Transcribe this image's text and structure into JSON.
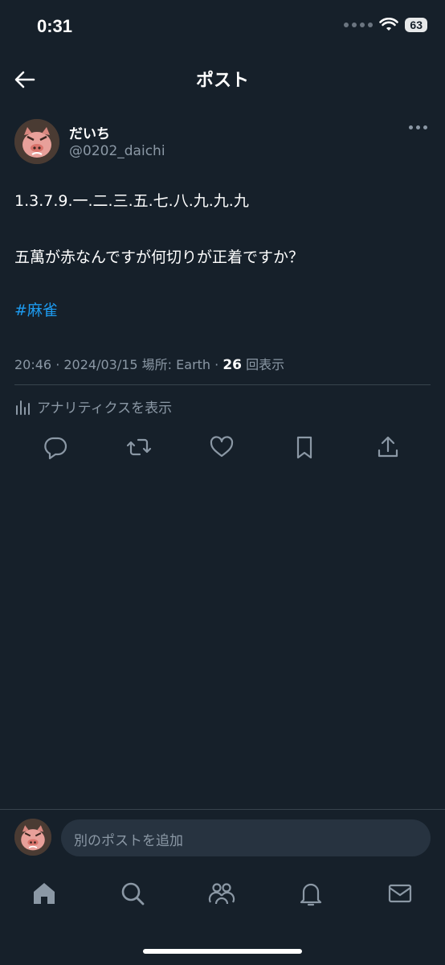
{
  "status_bar": {
    "time": "0:31",
    "battery": "63"
  },
  "header": {
    "title": "ポスト"
  },
  "post": {
    "author_name": "だいち",
    "author_handle": "@0202_daichi",
    "line1": "1.3.7.9.一.二.三.五.七.八.九.九.九",
    "line2": "五萬が赤なんですが何切りが正着ですか？",
    "hashtag": "#麻雀",
    "meta_prefix": "20:46 · 2024/03/15  場所: Earth · ",
    "views_count": "26",
    "views_label": " 回表示",
    "analytics_label": "アナリティクスを表示"
  },
  "reply": {
    "placeholder": "別のポストを追加"
  },
  "icons": {
    "back": "arrow-left-icon",
    "more": "more-icon",
    "reply": "reply-icon",
    "repost": "repost-icon",
    "like": "heart-icon",
    "bookmark": "bookmark-icon",
    "share": "share-icon",
    "home": "home-icon",
    "search": "search-icon",
    "communities": "communities-icon",
    "notifications": "bell-icon",
    "messages": "mail-icon"
  },
  "colors": {
    "background": "#16202a",
    "accent": "#1d9bf0",
    "secondary_text": "#8b98a5"
  }
}
